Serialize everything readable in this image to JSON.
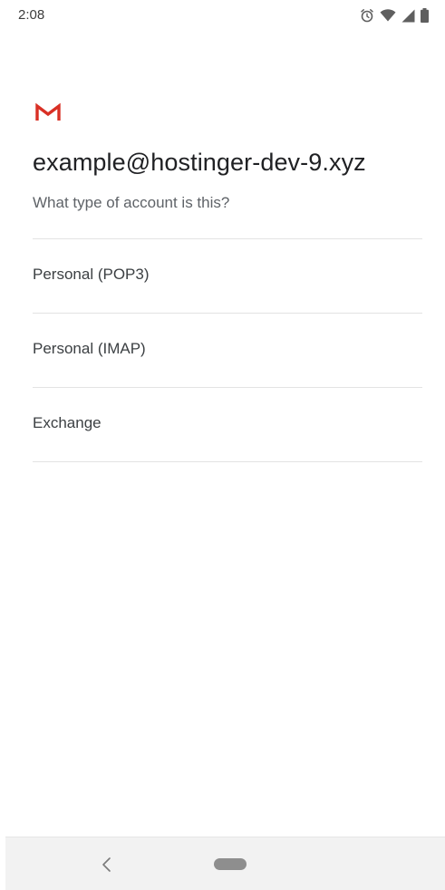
{
  "status_bar": {
    "time": "2:08",
    "icons": [
      "alarm-icon",
      "wifi-icon",
      "cell-signal-icon",
      "battery-icon"
    ]
  },
  "header": {
    "logo": "gmail-logo",
    "logo_color": "#d93025",
    "email": "example@hostinger-dev-9.xyz",
    "prompt": "What type of account is this?"
  },
  "account_types": [
    {
      "label": "Personal (POP3)"
    },
    {
      "label": "Personal (IMAP)"
    },
    {
      "label": "Exchange"
    }
  ],
  "nav_bar": {
    "back": "chevron-left-icon",
    "home": "home-pill"
  }
}
